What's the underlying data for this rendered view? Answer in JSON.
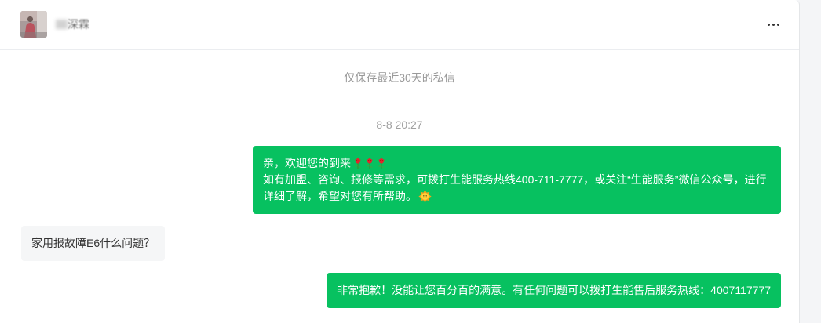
{
  "header": {
    "username": "深霖",
    "more_icon": "more-horizontal-icon"
  },
  "notice": {
    "text": "仅保存最近30天的私信"
  },
  "timestamp": "8-8 20:27",
  "messages": [
    {
      "direction": "outgoing",
      "lines": [
        {
          "text": "亲，欢迎您的到来",
          "icons": [
            "rose-emoji-icon",
            "rose-emoji-icon",
            "rose-emoji-icon"
          ]
        },
        {
          "text": "如有加盟、咨询、报修等需求，可拨打生能服务热线400-711-7777，或关注“生能服务”微信公众号，进行详细了解，希望对您有所帮助。",
          "icons": [
            "sun-emoji-icon"
          ]
        }
      ]
    },
    {
      "direction": "incoming",
      "text": "家用报故障E6什么问题？"
    },
    {
      "direction": "outgoing",
      "text": "非常抱歉！没能让您百分百的满意。有任何问题可以拨打生能售后服务热线：4007117777"
    }
  ],
  "colors": {
    "outgoing_bubble": "#07c160",
    "incoming_bubble": "#f5f6f7",
    "outgoing_text": "#ffffff",
    "incoming_text": "#333333",
    "muted_text": "#999999"
  }
}
